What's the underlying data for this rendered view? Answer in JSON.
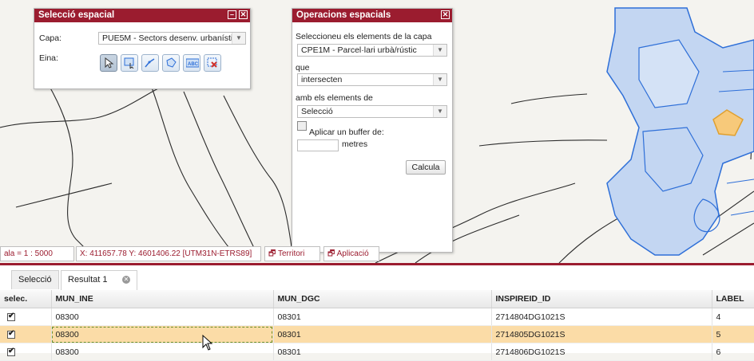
{
  "colors": {
    "accent": "#9b1c2f",
    "highlight_row": "#fbdca7",
    "parcel_fill": "#c3d6f2",
    "parcel_stroke": "#2e6fd8",
    "selected_parcel": "#f7c97a"
  },
  "spatial_selection": {
    "title": "Selecció espacial",
    "layer_label": "Capa:",
    "layer_value": "PUE5M - Sectors desenv. urbanísti",
    "tool_label": "Eina:",
    "tools": [
      "select-point-icon",
      "select-rectangle-icon",
      "select-line-icon",
      "select-polygon-icon",
      "select-by-text-icon",
      "clear-selection-icon"
    ],
    "tool_text_abc": "ABC"
  },
  "spatial_operations": {
    "title": "Operacions espacials",
    "select_elements_label": "Seleccioneu els elements de la capa",
    "layer_value": "CPE1M - Parcel·lari urbà/rústic",
    "que_label": "que",
    "operation_value": "intersecten",
    "with_elements_label": "amb els elements de",
    "source_value": "Selecció",
    "buffer_label": "Aplicar un buffer de:",
    "buffer_value": "",
    "units_label": "metres",
    "calc_button": "Calcula"
  },
  "status_bar": {
    "scale": "ala = 1 : 5000",
    "coords": "X: 411657.78 Y: 4601406.22 [UTM31N-ETRS89]",
    "territori": "Territori",
    "aplicacio": "Aplicació"
  },
  "results": {
    "tabs": [
      {
        "label": "Selecció"
      },
      {
        "label": "Resultat 1"
      }
    ],
    "columns": [
      "selec.",
      "MUN_INE",
      "MUN_DGC",
      "INSPIREID_ID",
      "LABEL"
    ],
    "rows": [
      {
        "checked": true,
        "mun_ine": "08300",
        "mun_dgc": "08301",
        "inspireid": "2714804DG1021S",
        "label": "4"
      },
      {
        "checked": true,
        "mun_ine": "08300",
        "mun_dgc": "08301",
        "inspireid": "2714805DG1021S",
        "label": "5"
      },
      {
        "checked": true,
        "mun_ine": "08300",
        "mun_dgc": "08301",
        "inspireid": "2714806DG1021S",
        "label": "6"
      }
    ]
  }
}
